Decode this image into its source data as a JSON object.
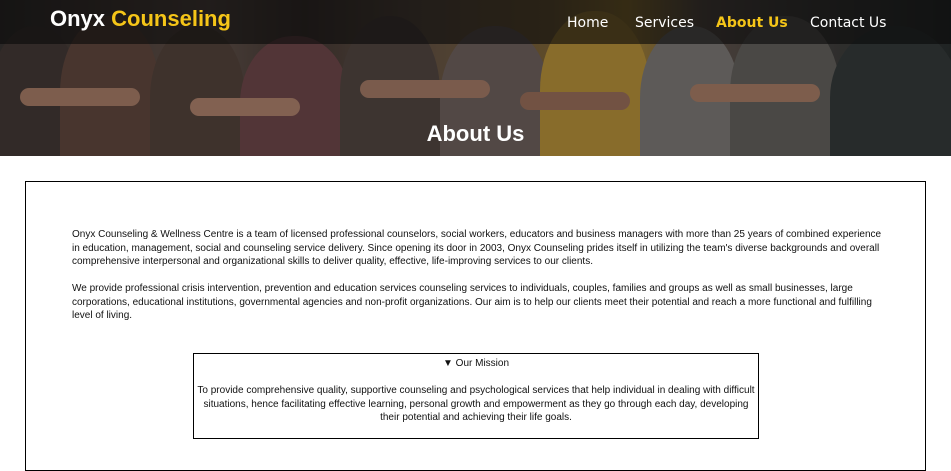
{
  "brand": {
    "name_part1": "Onyx",
    "name_part2": "Counseling"
  },
  "nav": {
    "items": [
      {
        "label": "Home"
      },
      {
        "label": "Services"
      },
      {
        "label": "About Us"
      },
      {
        "label": "Contact Us"
      }
    ],
    "active_color": "#f5c518"
  },
  "hero": {
    "title": "About Us"
  },
  "content": {
    "paragraphs": [
      "Onyx Counseling & Wellness Centre is a team of licensed professional counselors, social workers, educators and business managers with more than 25 years of combined experience in education, management, social and counseling service delivery. Since opening its door in 2003, Onyx Counseling prides itself in utilizing the team's diverse backgrounds and overall comprehensive interpersonal and organizational skills to deliver quality, effective, life-improving services to our clients.",
      "We provide professional crisis intervention, prevention and education services counseling services to individuals, couples, families and groups as well as small businesses, large corporations, educational institutions, governmental agencies and non-profit organizations. Our aim is to help our clients meet their potential and reach a more functional and fulfilling level of living."
    ],
    "mission": {
      "summary": "▼ Our Mission",
      "text": "To provide comprehensive quality, supportive counseling and psychological services that help individual in dealing with difficult situations, hence facilitating effective learning, personal growth and empowerment as they go through each day, developing their potential and achieving their life goals."
    }
  }
}
